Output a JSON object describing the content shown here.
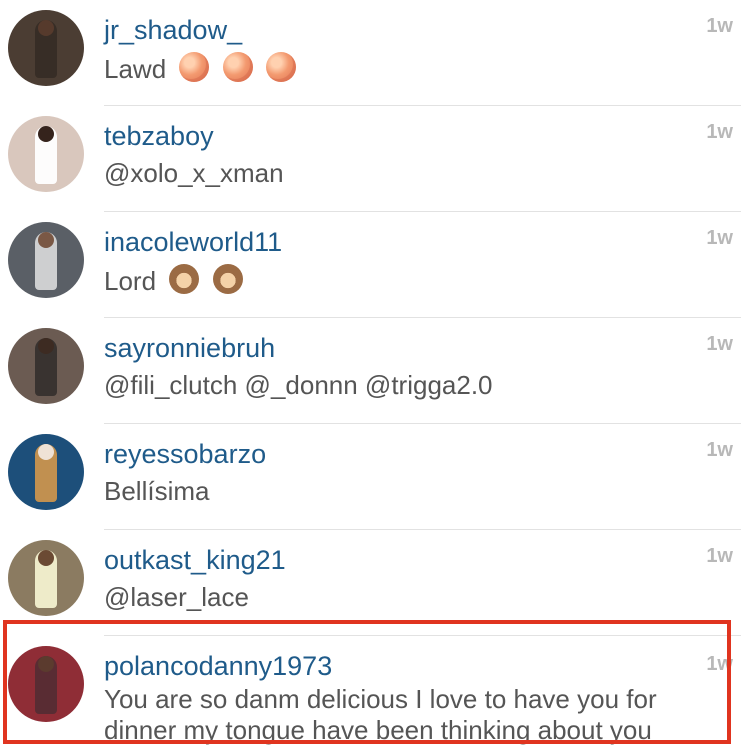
{
  "comments": [
    {
      "username": "jr_shadow_",
      "text": "Lawd",
      "emojis": [
        "peach-emoji",
        "peach-emoji",
        "peach-emoji"
      ],
      "time": "1w",
      "avatar_color": "#4b3d33"
    },
    {
      "username": "tebzaboy",
      "text": "@xolo_x_xman",
      "emojis": [],
      "time": "1w",
      "avatar_color": "#d9c7bd"
    },
    {
      "username": "inacoleworld11",
      "text": "Lord",
      "emojis": [
        "see-no-evil-monkey-emoji",
        "see-no-evil-monkey-emoji"
      ],
      "time": "1w",
      "avatar_color": "#5a5f66"
    },
    {
      "username": "sayronniebruh",
      "text": "@fili_clutch @_donnn @trigga2.0",
      "emojis": [],
      "time": "1w",
      "avatar_color": "#6b5b52"
    },
    {
      "username": "reyessobarzo",
      "text": "Bellísima",
      "emojis": [],
      "time": "1w",
      "avatar_color": "#1d4f7a"
    },
    {
      "username": "outkast_king21",
      "text": "@laser_lace",
      "emojis": [],
      "time": "1w",
      "avatar_color": "#8b7b61"
    },
    {
      "username": "polancodanny1973",
      "text": "You are so danm delicious I love to have you for dinner my tongue have been thinking about you",
      "emojis": [],
      "time": "1w",
      "avatar_color": "#8f2d36"
    }
  ],
  "highlight_color": "#e0341f",
  "username_color": "#1f5b8a"
}
